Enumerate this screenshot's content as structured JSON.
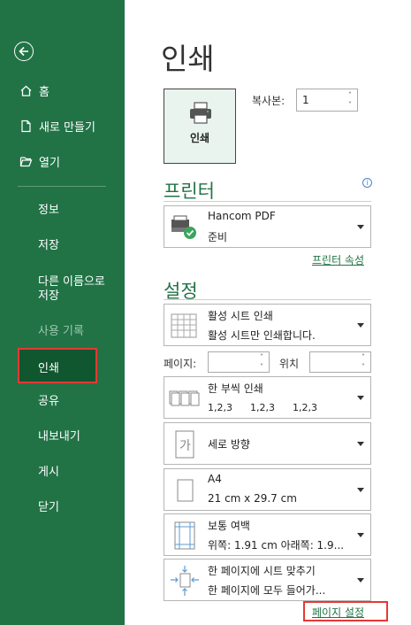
{
  "sidebar": {
    "back_label": "",
    "items_top": [
      {
        "label": "홈",
        "icon": "home-icon"
      },
      {
        "label": "새로 만들기",
        "icon": "new-document-icon"
      },
      {
        "label": "열기",
        "icon": "folder-open-icon"
      }
    ],
    "items_bottom": [
      {
        "label": "정보",
        "enabled": true
      },
      {
        "label": "저장",
        "enabled": true
      },
      {
        "label": "다른 이름으로 저장",
        "enabled": true
      },
      {
        "label": "사용 기록",
        "enabled": false
      },
      {
        "label": "인쇄",
        "enabled": true,
        "selected": true
      },
      {
        "label": "공유",
        "enabled": true
      },
      {
        "label": "내보내기",
        "enabled": true
      },
      {
        "label": "게시",
        "enabled": true
      },
      {
        "label": "닫기",
        "enabled": true
      }
    ],
    "other_name_line1": "다른 이름으로",
    "other_name_line2": "저장",
    "bg_color": "#217346"
  },
  "main": {
    "title": "인쇄",
    "print_button": {
      "label": "인쇄",
      "icon": "printer-icon"
    },
    "copies": {
      "label": "복사본:",
      "value": "1"
    },
    "printer": {
      "section_title": "프린터",
      "name": "Hancom PDF",
      "status": "준비",
      "properties_link": "프린터 속성",
      "icon": "printer-ready-icon"
    },
    "settings": {
      "section_title": "설정",
      "print_what": {
        "line1": "활성 시트 인쇄",
        "line2": "활성 시트만 인쇄합니다.",
        "icon": "sheet-grid-icon"
      },
      "pages_label": "페이지:",
      "pages_value": "",
      "position_label": "위치",
      "position_value": "",
      "collation": {
        "line1": "한 부씩 인쇄",
        "line2_a": "1,2,3",
        "line2_b": "1,2,3",
        "line2_c": "1,2,3",
        "icon": "collated-pages-icon"
      },
      "orientation": {
        "line1": "세로 방향",
        "icon": "portrait-orientation-icon"
      },
      "paper": {
        "line1": "A4",
        "line2": "21 cm x 29.7 cm",
        "icon": "paper-size-icon"
      },
      "margins": {
        "line1": "보통 여백",
        "line2": "위쪽: 1.91 cm 아래쪽: 1.9...",
        "icon": "margins-icon"
      },
      "scaling": {
        "line1": "한 페이지에 시트 맞추기",
        "line2": "한 페이지에 모두 들어가...",
        "icon": "fit-to-page-icon"
      },
      "page_setup_link": "페이지 설정"
    }
  },
  "colors": {
    "accent": "#217346",
    "highlight": "#e53935"
  }
}
